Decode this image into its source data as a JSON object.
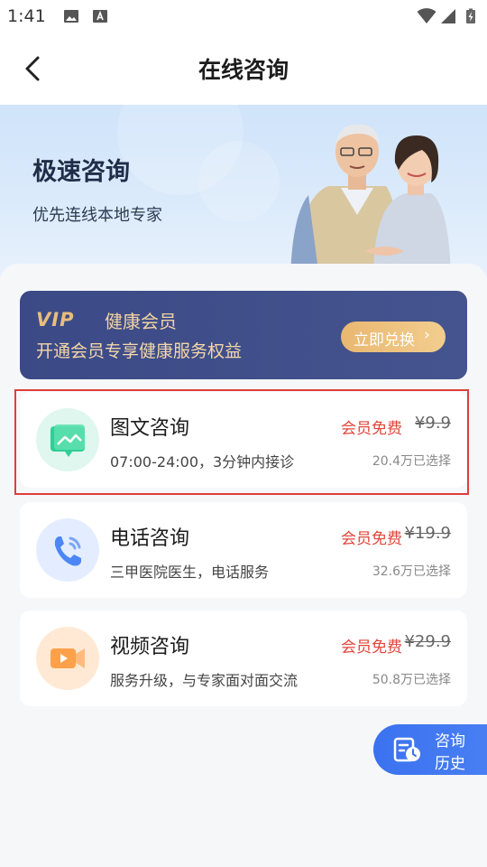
{
  "status_bar": {
    "time": "1:41"
  },
  "header": {
    "title": "在线咨询"
  },
  "hero": {
    "title": "极速咨询",
    "subtitle": "优先连线本地专家"
  },
  "vip": {
    "logo": "VIP",
    "title": "健康会员",
    "subtitle": "开通会员专享健康服务权益",
    "button": "立即兑换",
    "button_arrow": "›"
  },
  "services": [
    {
      "title": "图文咨询",
      "desc": "07:00-24:00，3分钟内接诊",
      "free": "会员免费",
      "price": "¥9.9",
      "count": "20.4万已选择",
      "icon": "image-chat-icon"
    },
    {
      "title": "电话咨询",
      "desc": "三甲医院医生，电话服务",
      "free": "会员免费",
      "price": "¥19.9",
      "count": "32.6万已选择",
      "icon": "phone-icon"
    },
    {
      "title": "视频咨询",
      "desc": "服务升级，与专家面对面交流",
      "free": "会员免费",
      "price": "¥29.9",
      "count": "50.8万已选择",
      "icon": "video-icon"
    }
  ],
  "history_button": {
    "line1": "咨询",
    "line2": "历史"
  },
  "colors": {
    "accent_blue": "#3b72f0",
    "vip_bg": "#3b4a86",
    "gold": "#e9bd7d",
    "red": "#e0463a",
    "highlight": "#e03c3c"
  }
}
